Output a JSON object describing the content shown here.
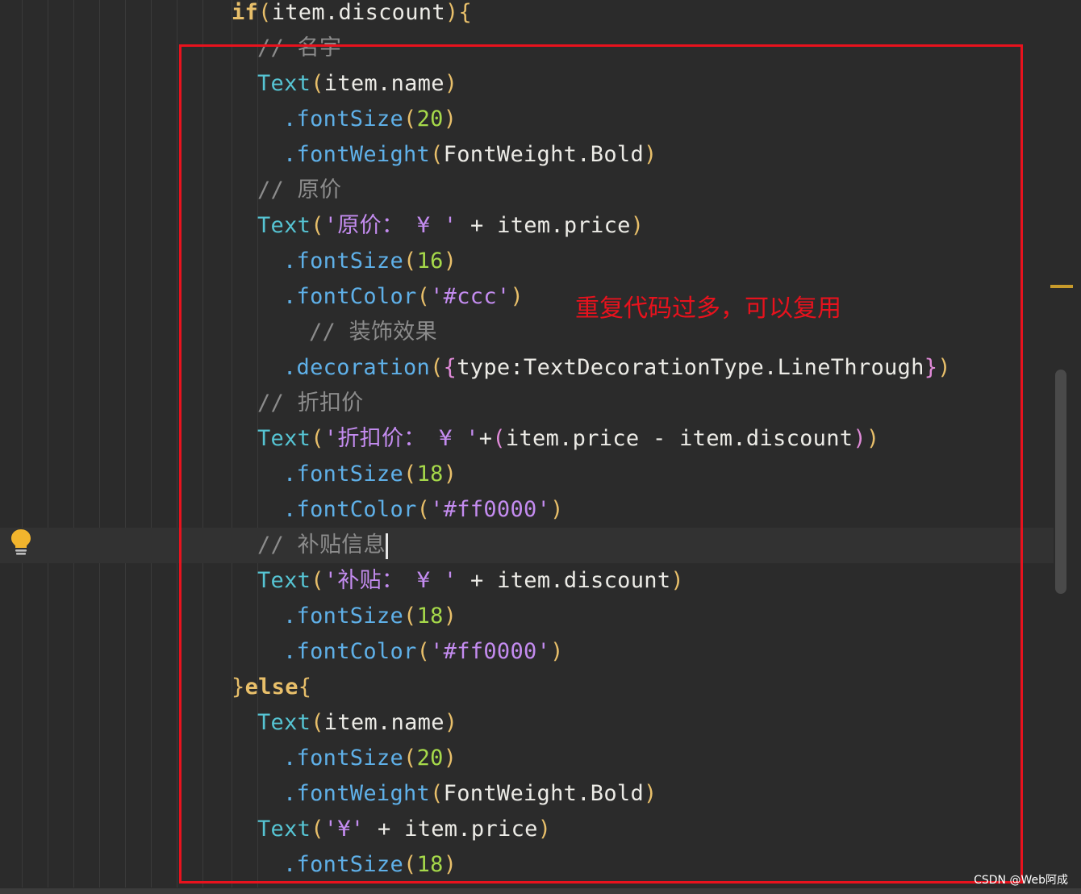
{
  "annotation": "重复代码过多，可以复用",
  "watermark": "CSDN @Web阿成",
  "colors": {
    "accent_red": "#e8121d",
    "background": "#2b2b2b",
    "keyword": "#e8bf6a"
  },
  "icons": {
    "gutter": "lightbulb-icon"
  },
  "code": {
    "l1": {
      "kw": "if",
      "p1": "(",
      "a": "item.discount",
      "p2": ")",
      "p3": "{"
    },
    "l2": {
      "comment": "// 名字"
    },
    "l3": {
      "cls": "Text",
      "p1": "(",
      "a": "item.name",
      "p2": ")"
    },
    "l4": {
      "fn": ".fontSize",
      "p1": "(",
      "num": "20",
      "p2": ")"
    },
    "l5": {
      "fn": ".fontWeight",
      "p1": "(",
      "a": "FontWeight.Bold",
      "p2": ")"
    },
    "l6": {
      "comment": "// 原价"
    },
    "l7": {
      "cls": "Text",
      "p1": "(",
      "str": "'原价： ¥ '",
      "op": " + ",
      "a": "item.price",
      "p2": ")"
    },
    "l8": {
      "fn": ".fontSize",
      "p1": "(",
      "num": "16",
      "p2": ")"
    },
    "l9": {
      "fn": ".fontColor",
      "p1": "(",
      "str": "'#ccc'",
      "p2": ")"
    },
    "l10": {
      "comment": "// 装饰效果"
    },
    "l11": {
      "fn": ".decoration",
      "p1": "(",
      "p2": "{",
      "a": "type:TextDecorationType.LineThrough",
      "p3": "}",
      "p4": ")"
    },
    "l12": {
      "comment": "// 折扣价"
    },
    "l13": {
      "cls": "Text",
      "p1": "(",
      "str": "'折扣价： ¥ '",
      "op": "+",
      "p2": "(",
      "a": "item.price - item.discount",
      "p3": ")",
      "p4": ")"
    },
    "l14": {
      "fn": ".fontSize",
      "p1": "(",
      "num": "18",
      "p2": ")"
    },
    "l15": {
      "fn": ".fontColor",
      "p1": "(",
      "str": "'#ff0000'",
      "p2": ")"
    },
    "l16": {
      "comment": "// 补贴信息"
    },
    "l17": {
      "cls": "Text",
      "p1": "(",
      "str": "'补贴： ¥ '",
      "op": " + ",
      "a": "item.discount",
      "p2": ")"
    },
    "l18": {
      "fn": ".fontSize",
      "p1": "(",
      "num": "18",
      "p2": ")"
    },
    "l19": {
      "fn": ".fontColor",
      "p1": "(",
      "str": "'#ff0000'",
      "p2": ")"
    },
    "l20": {
      "p1": "}",
      "kw": "else",
      "p2": "{"
    },
    "l21": {
      "cls": "Text",
      "p1": "(",
      "a": "item.name",
      "p2": ")"
    },
    "l22": {
      "fn": ".fontSize",
      "p1": "(",
      "num": "20",
      "p2": ")"
    },
    "l23": {
      "fn": ".fontWeight",
      "p1": "(",
      "a": "FontWeight.Bold",
      "p2": ")"
    },
    "l24": {
      "cls": "Text",
      "p1": "(",
      "str": "'¥'",
      "op": " + ",
      "a": "item.price",
      "p2": ")"
    },
    "l25": {
      "fn": ".fontSize",
      "p1": "(",
      "num": "18",
      "p2": ")"
    }
  }
}
